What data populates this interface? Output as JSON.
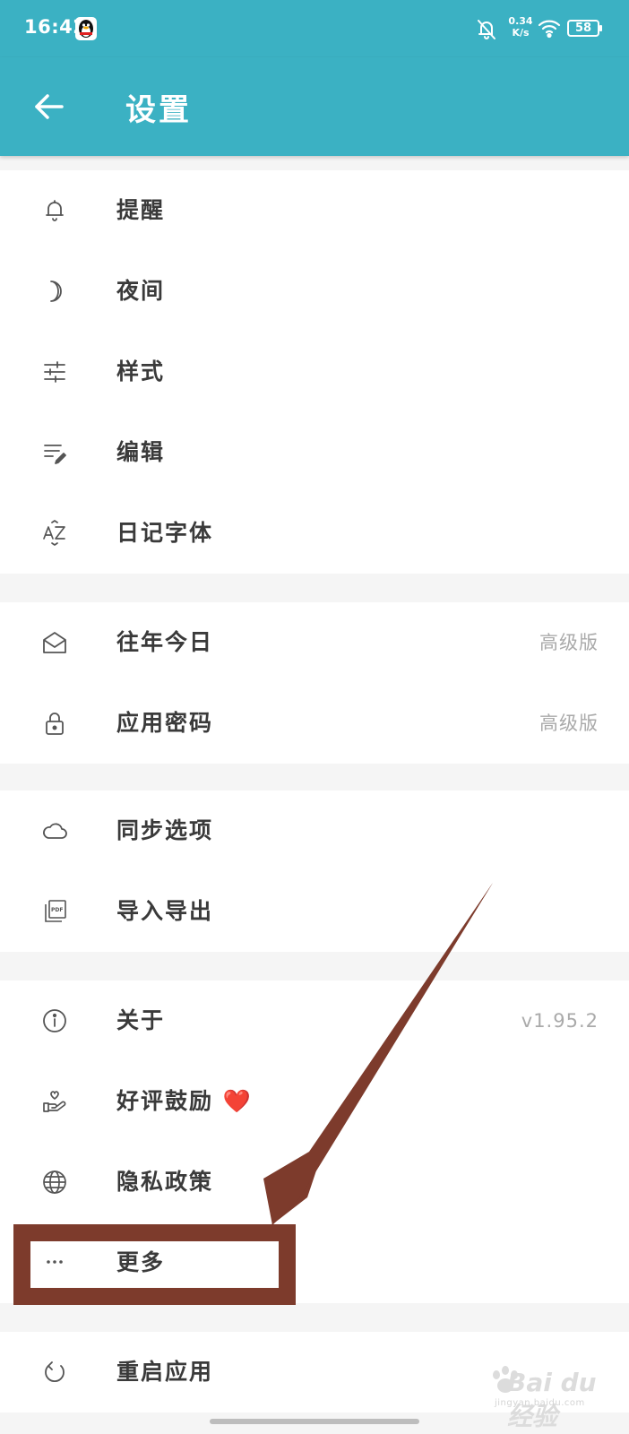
{
  "status_bar": {
    "time": "16:42",
    "net_speed_value": "0.34",
    "net_speed_unit": "K/s",
    "battery": "58"
  },
  "header": {
    "title": "设置"
  },
  "groups": [
    {
      "items": [
        {
          "label": "提醒",
          "icon": "bell-icon"
        },
        {
          "label": "夜间",
          "icon": "moon-icon"
        },
        {
          "label": "样式",
          "icon": "sliders-icon"
        },
        {
          "label": "编辑",
          "icon": "edit-lines-icon"
        },
        {
          "label": "日记字体",
          "icon": "font-az-icon"
        }
      ]
    },
    {
      "items": [
        {
          "label": "往年今日",
          "icon": "envelope-open-icon",
          "value": "高级版"
        },
        {
          "label": "应用密码",
          "icon": "lock-icon",
          "value": "高级版"
        }
      ]
    },
    {
      "items": [
        {
          "label": "同步选项",
          "icon": "cloud-icon"
        },
        {
          "label": "导入导出",
          "icon": "pdf-file-icon"
        }
      ]
    },
    {
      "items": [
        {
          "label": "关于",
          "icon": "info-icon",
          "value": "v1.95.2"
        },
        {
          "label": "好评鼓励 ❤️",
          "icon": "hand-heart-icon"
        },
        {
          "label": "隐私政策",
          "icon": "globe-icon"
        },
        {
          "label": "更多",
          "icon": "more-dots-icon"
        }
      ]
    },
    {
      "items": [
        {
          "label": "重启应用",
          "icon": "restart-icon"
        }
      ]
    }
  ],
  "watermark": {
    "brand": "Bai du 经验",
    "url": "jingyan.baidu.com"
  },
  "colors": {
    "primary": "#3bb1c3",
    "annotation": "#7d3b2c",
    "background": "#f5f5f5",
    "secondary_text": "#aaaaaa"
  }
}
